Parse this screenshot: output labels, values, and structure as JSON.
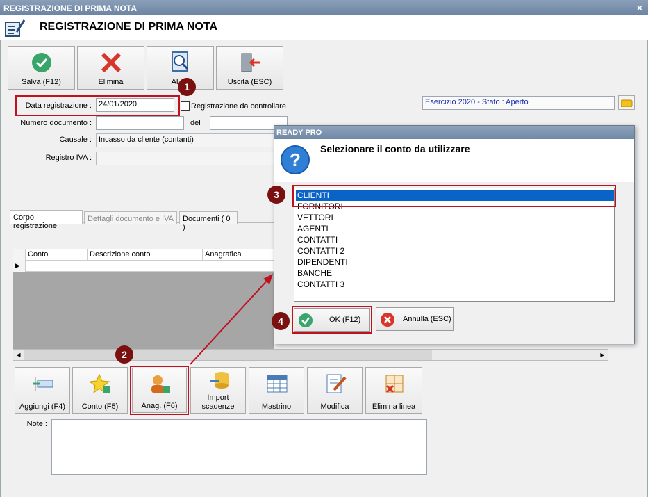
{
  "window": {
    "title": "REGISTRAZIONE DI PRIMA NOTA",
    "close_glyph": "×"
  },
  "header": {
    "title": "REGISTRAZIONE DI PRIMA NOTA"
  },
  "toolbar": {
    "save": "Salva (F12)",
    "delete": "Elimina",
    "other": "Al",
    "exit": "Uscita (ESC)"
  },
  "form": {
    "date_label": "Data registrazione :",
    "date_value": "24/01/2020",
    "check_label": "Registrazione da controllare",
    "docnum_label": "Numero documento :",
    "docnum_value": "",
    "del_label": "del",
    "causale_label": "Causale :",
    "causale_value": "Incasso da cliente (contanti)",
    "registro_label": "Registro IVA :",
    "registro_value": ""
  },
  "status": {
    "esercizio": "Esercizio 2020 - Stato : Aperto"
  },
  "tabs": [
    "Corpo registrazione",
    "Dettagli documento e IVA",
    "Documenti ( 0 )"
  ],
  "grid": {
    "columns": [
      "Conto",
      "Descrizione conto",
      "Anagrafica"
    ]
  },
  "bottom_buttons": {
    "add": "Aggiungi (F4)",
    "account": "Conto (F5)",
    "anag": "Anag. (F6)",
    "import1": "Import",
    "import2": "scadenze",
    "ledger": "Mastrino",
    "edit": "Modifica",
    "delete_line": "Elimina linea"
  },
  "notes": {
    "label": "Note :"
  },
  "dialog": {
    "title": "READY PRO",
    "question": "Selezionare il conto da utilizzare",
    "items": [
      "CLIENTI",
      "FORNITORI",
      "VETTORI",
      "AGENTI",
      "CONTATTI",
      "CONTATTI 2",
      "DIPENDENTI",
      "BANCHE",
      "CONTATTI 3"
    ],
    "selected_index": 0,
    "ok": "OK (F12)",
    "cancel": "Annulla (ESC)"
  },
  "badges": [
    "1",
    "2",
    "3",
    "4"
  ],
  "colors": {
    "accent_red": "#c0111f",
    "selection_blue": "#0a64c8",
    "badge": "#7a1010"
  }
}
